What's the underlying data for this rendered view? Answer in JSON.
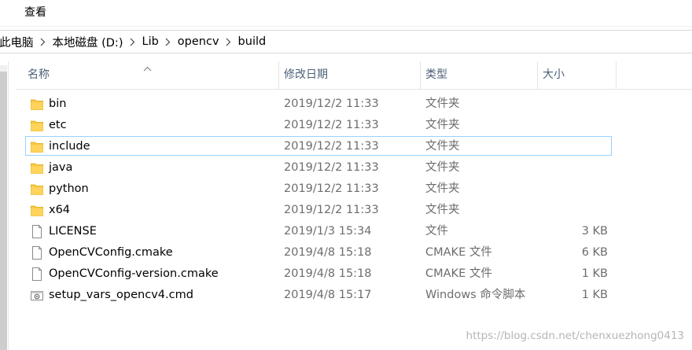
{
  "menu": {
    "view_label": "查看"
  },
  "breadcrumb": [
    "此电脑",
    "本地磁盘 (D:)",
    "Lib",
    "opencv",
    "build"
  ],
  "columns": {
    "name": "名称",
    "date": "修改日期",
    "type": "类型",
    "size": "大小"
  },
  "files": [
    {
      "name": "bin",
      "date": "2019/12/2 11:33",
      "type": "文件夹",
      "size": "",
      "icon": "folder-icon"
    },
    {
      "name": "etc",
      "date": "2019/12/2 11:33",
      "type": "文件夹",
      "size": "",
      "icon": "folder-icon"
    },
    {
      "name": "include",
      "date": "2019/12/2 11:33",
      "type": "文件夹",
      "size": "",
      "icon": "folder-icon",
      "focused": true
    },
    {
      "name": "java",
      "date": "2019/12/2 11:33",
      "type": "文件夹",
      "size": "",
      "icon": "folder-icon"
    },
    {
      "name": "python",
      "date": "2019/12/2 11:33",
      "type": "文件夹",
      "size": "",
      "icon": "folder-icon"
    },
    {
      "name": "x64",
      "date": "2019/12/2 11:33",
      "type": "文件夹",
      "size": "",
      "icon": "folder-icon"
    },
    {
      "name": "LICENSE",
      "date": "2019/1/3 15:34",
      "type": "文件",
      "size": "3 KB",
      "icon": "file-icon"
    },
    {
      "name": "OpenCVConfig.cmake",
      "date": "2019/4/8 15:18",
      "type": "CMAKE 文件",
      "size": "6 KB",
      "icon": "file-icon"
    },
    {
      "name": "OpenCVConfig-version.cmake",
      "date": "2019/4/8 15:18",
      "type": "CMAKE 文件",
      "size": "1 KB",
      "icon": "file-icon"
    },
    {
      "name": "setup_vars_opencv4.cmd",
      "date": "2019/4/8 15:17",
      "type": "Windows 命令脚本",
      "size": "1 KB",
      "icon": "cmd-script-icon"
    }
  ],
  "watermark": "https://blog.csdn.net/chenxuezhong0413",
  "colors": {
    "header_text": "#4c607a",
    "secondary_text": "#6d6d6d",
    "focus_border": "#99d1ff",
    "folder": "#f7c948"
  }
}
